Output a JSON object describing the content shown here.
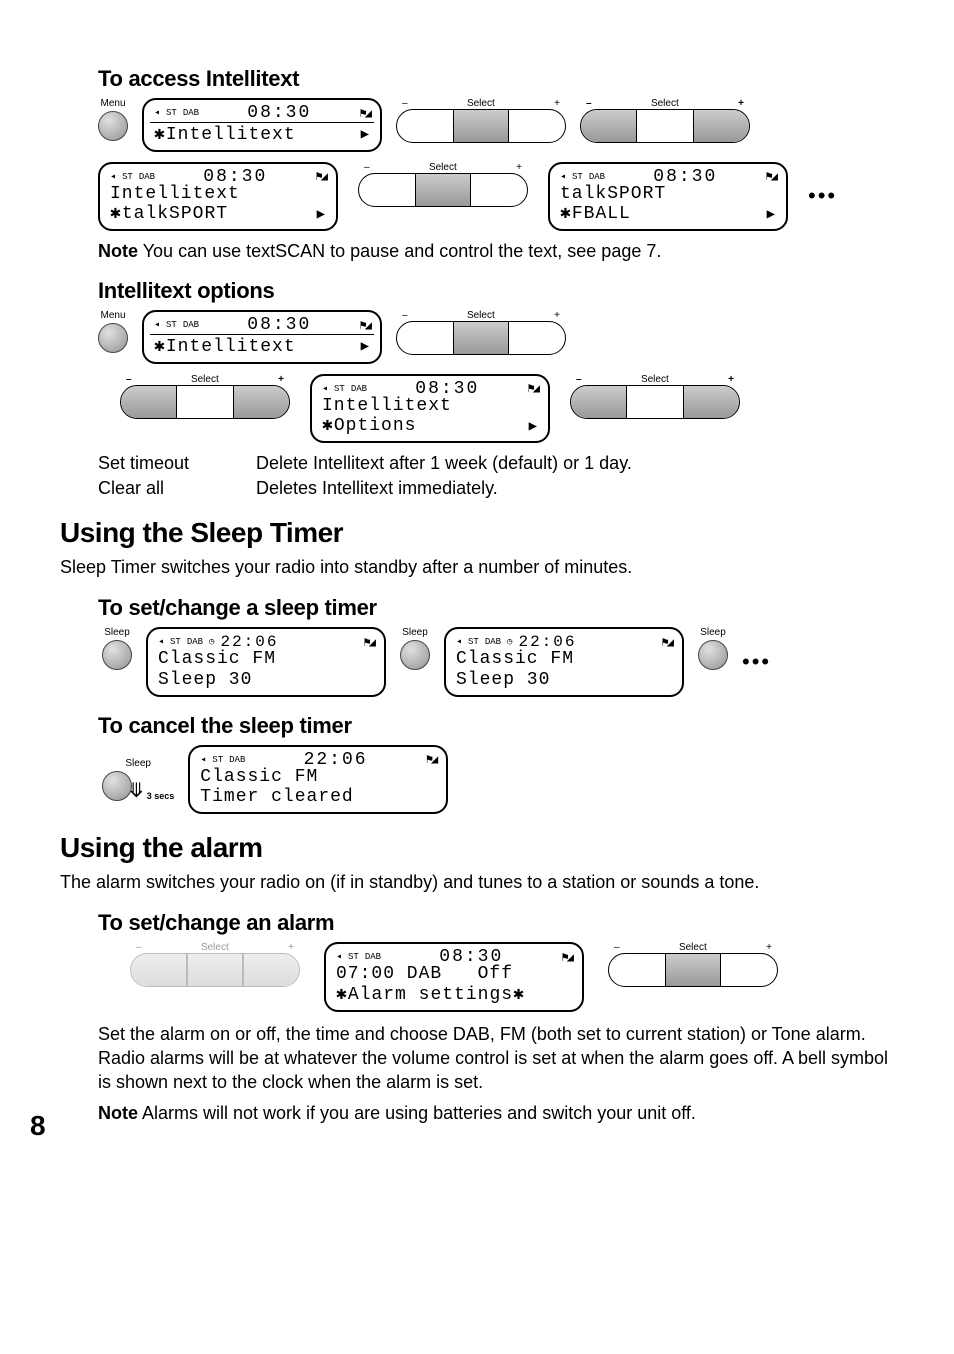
{
  "sections": {
    "intellitext_access": {
      "heading": "To access Intellitext"
    },
    "intellitext_options": {
      "heading": "Intellitext options"
    },
    "sleep_timer": {
      "heading": "Using the Sleep Timer",
      "intro": "Sleep Timer switches your radio into standby after a number of minutes.",
      "set_heading": "To set/change a sleep timer",
      "cancel_heading": "To cancel the sleep timer"
    },
    "alarm": {
      "heading": "Using the alarm",
      "intro": "The alarm switches your radio on (if in standby) and tunes to a station or sounds a tone.",
      "set_heading": "To set/change an alarm",
      "body": "Set the alarm on or off, the time and choose DAB, FM (both set to current station) or Tone alarm. Radio alarms will be at whatever the volume control is set at when the alarm goes off. A bell symbol is shown next to the clock when the alarm is set."
    }
  },
  "labels": {
    "menu": "Menu",
    "sleep": "Sleep",
    "select": "Select",
    "minus": "–",
    "plus": "+",
    "secs3": "3 secs",
    "note": "Note",
    "ellipsis": "•••"
  },
  "notes": {
    "textscan": "You can use textSCAN to pause and control the text, see page 7.",
    "battery": "Alarms will not work if you are using batteries and switch your unit off."
  },
  "options": [
    {
      "k": "Set timeout",
      "v": "Delete Intellitext after 1 week (default) or 1 day."
    },
    {
      "k": "Clear all",
      "v": "Deletes Intellitext immediately."
    }
  ],
  "lcd": {
    "indicators": {
      "st": "ST",
      "dab": "DAB",
      "tri": "◂",
      "sig_full": "▮◢",
      "sig_flag": "⚑◢",
      "clock": "◷"
    },
    "screens": {
      "intellitext_menu": {
        "time": "08:30",
        "line": "Intellitext"
      },
      "intellitext_talk": {
        "time": "08:30",
        "l1": "Intellitext",
        "l2": "talkSPORT"
      },
      "talksport_fball": {
        "time": "08:30",
        "l1": "talkSPORT",
        "l2": "FBALL"
      },
      "intellitext_options": {
        "time": "08:30",
        "l1": "Intellitext",
        "l2": "Options"
      },
      "sleep30": {
        "time": "22:06",
        "l1": "Classic FM",
        "l2": "Sleep 30"
      },
      "timer_cleared": {
        "time": "22:06",
        "l1": "Classic FM",
        "l2": "Timer cleared"
      },
      "alarm_settings": {
        "time": "08:30",
        "l1": "07:00 DAB   Off",
        "l2": "Alarm settings"
      }
    }
  },
  "page": "8"
}
